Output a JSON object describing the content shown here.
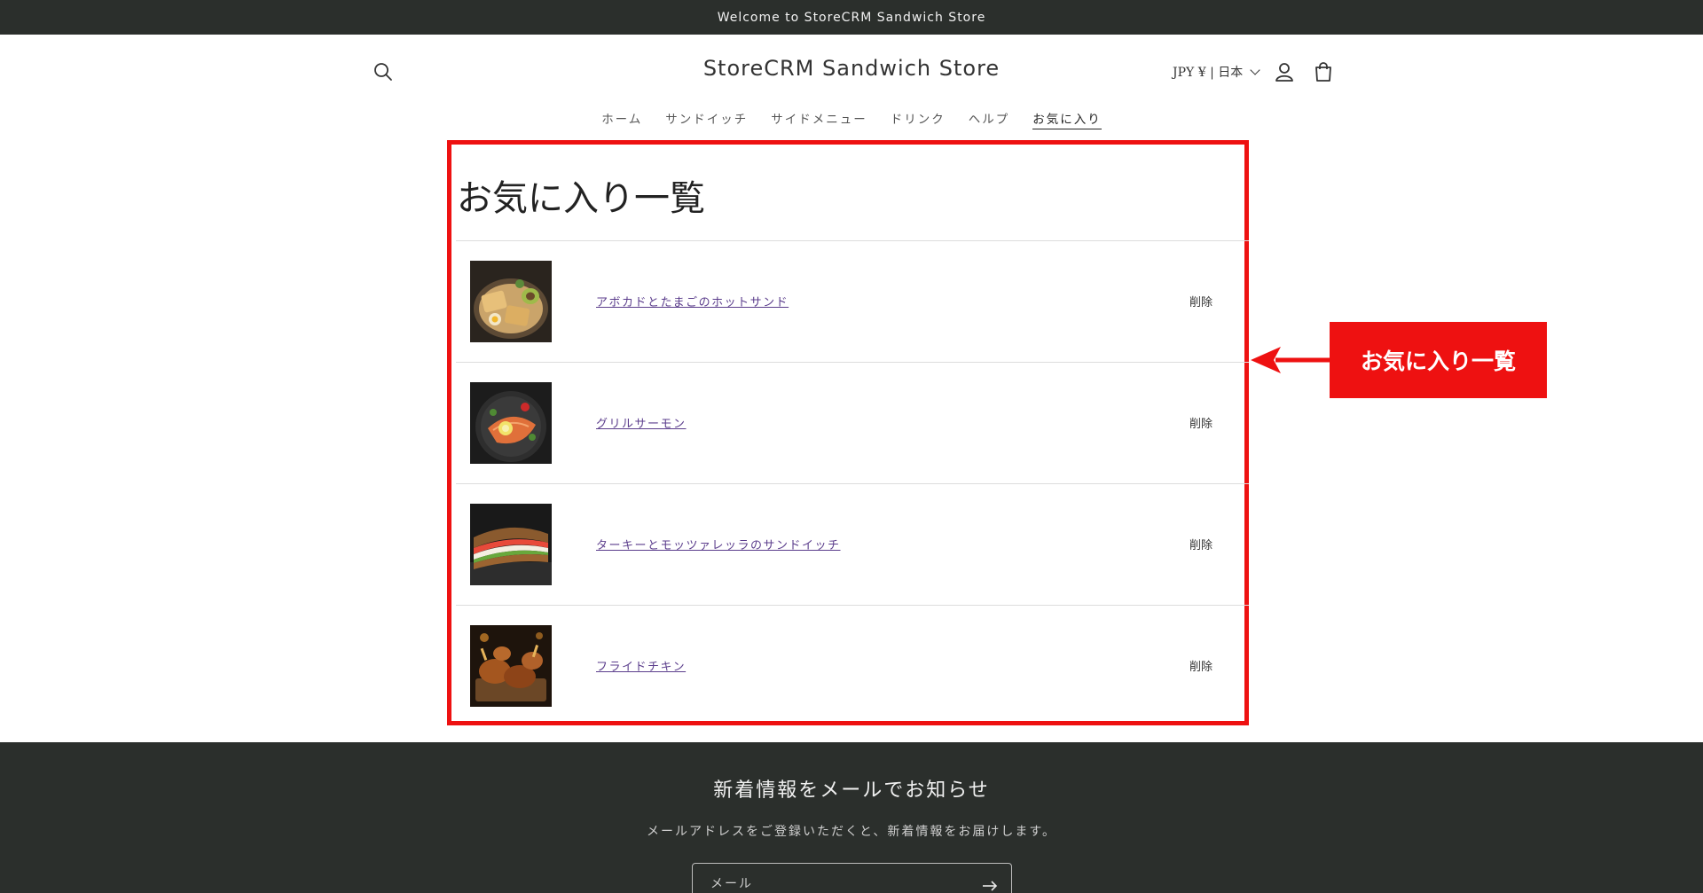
{
  "announcement": "Welcome to StoreCRM Sandwich Store",
  "header": {
    "brand": "StoreCRM Sandwich Store",
    "currency": "JPY ¥ | 日本"
  },
  "nav": [
    "ホーム",
    "サンドイッチ",
    "サイドメニュー",
    "ドリンク",
    "ヘルプ",
    "お気に入り"
  ],
  "wishlist": {
    "title": "お気に入り一覧",
    "remove_label": "削除",
    "items": [
      {
        "name": "アボカドとたまごのホットサンド"
      },
      {
        "name": "グリルサーモン"
      },
      {
        "name": "ターキーとモッツァレッラのサンドイッチ"
      },
      {
        "name": "フライドチキン"
      }
    ]
  },
  "callout": "お気に入り一覧",
  "footer": {
    "title": "新着情報をメールでお知らせ",
    "description": "メールアドレスをご登録いただくと、新着情報をお届けします。",
    "email_placeholder": "メール"
  },
  "colors": {
    "dark_bg": "#2b2f2c",
    "highlight_red": "#ee1111",
    "link_purple": "#5b3d8c"
  }
}
